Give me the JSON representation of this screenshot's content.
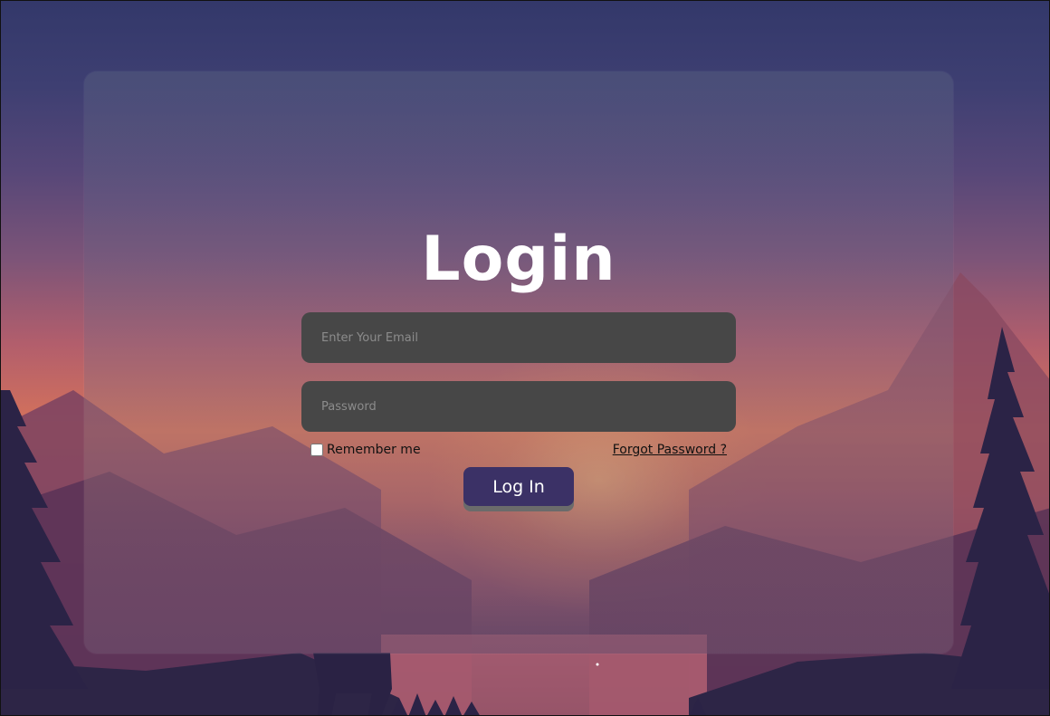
{
  "login_card": {
    "title": "Login",
    "email_input": {
      "placeholder": "Enter Your Email",
      "value": ""
    },
    "password_input": {
      "placeholder": "Password",
      "value": ""
    },
    "remember_me": {
      "label": "Remember me",
      "checked": false
    },
    "forgot_password_link": "Forgot Password ?",
    "login_button": "Log In"
  },
  "colors": {
    "button": "#3b3166",
    "input_background": "#474747",
    "title_text": "#ffffff"
  }
}
